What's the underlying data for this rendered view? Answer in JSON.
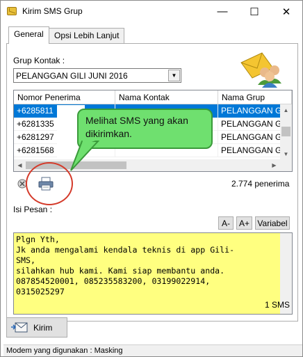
{
  "window": {
    "title": "Kirim SMS Grup",
    "minimize": "—",
    "maximize": "☐",
    "close": "✕"
  },
  "tabs": [
    {
      "label": "General"
    },
    {
      "label": "Opsi Lebih Lanjut"
    }
  ],
  "grup_kontak": {
    "label": "Grup Kontak :",
    "selected": "PELANGGAN GILI JUNI 2016"
  },
  "grid": {
    "columns": [
      "Nomor Penerima",
      "Nama Kontak",
      "Nama Grup"
    ],
    "rows": [
      {
        "nomor": "+6285811",
        "nama": "",
        "grup": "PELANGGAN GILI"
      },
      {
        "nomor": "+6281335",
        "nama": "",
        "grup": "PELANGGAN GILI"
      },
      {
        "nomor": "+6281297",
        "nama": "",
        "grup": "PELANGGAN GILI"
      },
      {
        "nomor": "+6281568",
        "nama": "",
        "grup": "PELANGGAN GILI"
      }
    ]
  },
  "recipient_count": "2.774 penerima",
  "buttons": {
    "font_smaller": "A-",
    "font_larger": "A+",
    "variabel": "Variabel",
    "send": "Kirim"
  },
  "message": {
    "label": "Isi Pesan :",
    "text": "Plgn Yth,\nJk anda mengalami kendala teknis di app Gili-\nSMS,\nsilahkan hub kami. Kami siap membantu anda.\n087854520001, 085235583200, 03199022914,\n0315025297",
    "sms_count": "1 SMS"
  },
  "callout": {
    "text": "Melihat SMS yang akan dikirimkan."
  },
  "status_bar": {
    "text": "Modem yang digunakan : Masking"
  },
  "icons": {
    "app": "sms-envelope-icon",
    "group": "contact-group-icon",
    "clear": "clear-icon",
    "print": "printer-icon"
  },
  "colors": {
    "selection": "#0078d7",
    "message_bg": "#ffff80",
    "callout_bg": "#6fe06f",
    "highlight_circle": "#d43a2a"
  }
}
